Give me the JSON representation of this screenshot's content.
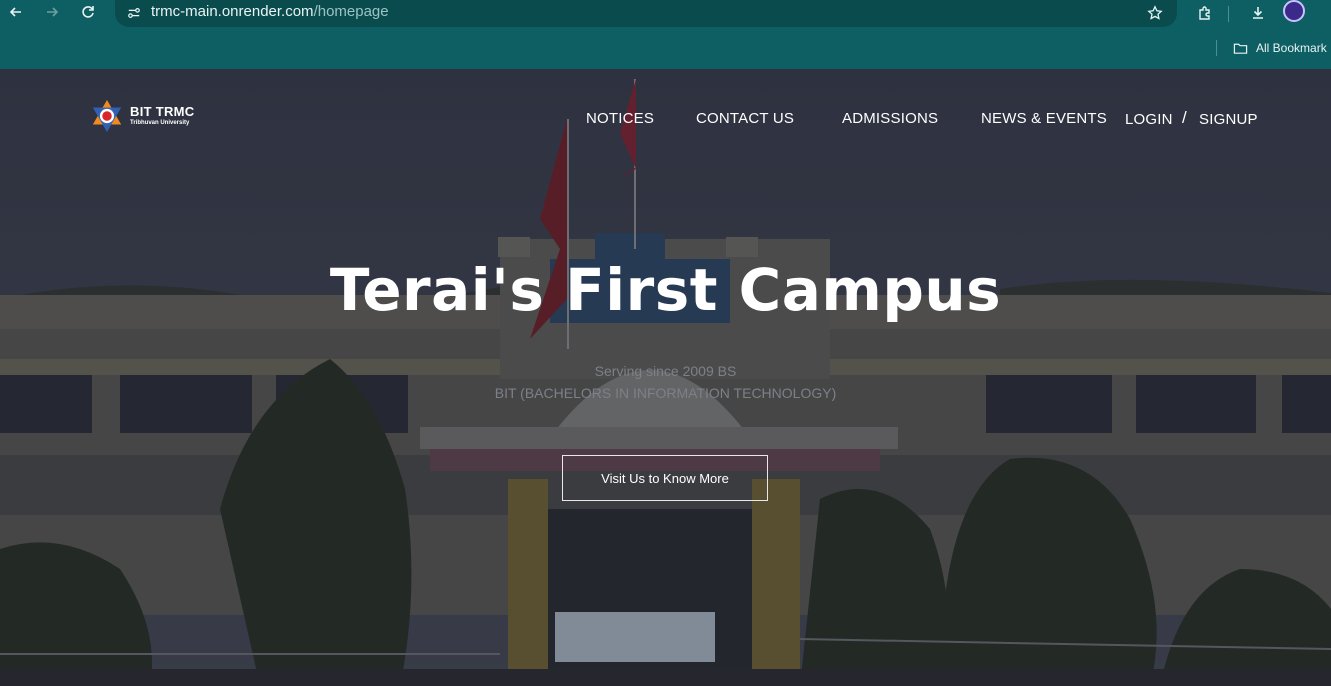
{
  "browser": {
    "url_host": "trmc-main.onrender.com",
    "url_path": "/homepage",
    "bookmarks_label": "All Bookmark",
    "icons": [
      "back-icon",
      "forward-icon",
      "reload-icon",
      "site-info-icon",
      "star-icon",
      "extensions-icon",
      "download-icon",
      "profile-avatar",
      "folder-icon"
    ],
    "colors": {
      "chrome": "#0e5f63",
      "omnibox": "#0a4b4e"
    }
  },
  "site": {
    "logo": {
      "title": "BIT TRMC",
      "subtitle": "Tribhuvan University"
    },
    "nav": [
      {
        "label": "NOTICES"
      },
      {
        "label": "CONTACT US"
      },
      {
        "label": "ADMISSIONS"
      },
      {
        "label": "NEWS & EVENTS"
      }
    ],
    "auth": {
      "login": "LOGIN",
      "separator": "/",
      "signup": "SIGNUP"
    },
    "hero": {
      "title": "Terai's First Campus",
      "subtitle_1": "Serving since 2009 BS",
      "subtitle_2": "BIT (BACHELORS IN INFORMATION TECHNOLOGY)",
      "cta": "Visit Us to Know More"
    }
  }
}
